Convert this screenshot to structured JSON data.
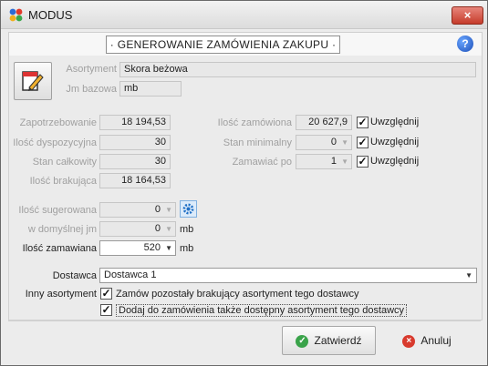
{
  "window": {
    "title": "MODUS",
    "close_glyph": "×"
  },
  "header": {
    "title": "· GENEROWANIE ZAMÓWIENIA ZAKUPU ·",
    "help_glyph": "?"
  },
  "product": {
    "asortyment_label": "Asortyment",
    "asortyment_value": "Skora beżowa",
    "jm_label": "Jm bazowa",
    "jm_value": "mb"
  },
  "stats_left": [
    {
      "label": "Zapotrzebowanie",
      "value": "18 194,53"
    },
    {
      "label": "Ilość dyspozycyjna",
      "value": "30"
    },
    {
      "label": "Stan całkowity",
      "value": "30"
    },
    {
      "label": "Ilość brakująca",
      "value": "18 164,53"
    }
  ],
  "stats_right": [
    {
      "label": "Ilość zamówiona",
      "value": "20 627,9",
      "check_label": "Uwzględnij",
      "checked": true
    },
    {
      "label": "Stan minimalny",
      "value": "0",
      "check_label": "Uwzględnij",
      "checked": true
    },
    {
      "label": "Zamawiać po",
      "value": "1",
      "check_label": "Uwzględnij",
      "checked": true
    }
  ],
  "quantity": {
    "sugerowana_label": "Ilość sugerowana",
    "sugerowana_value": "0",
    "domyslny_label": "w domyślnej jm",
    "domyslny_value": "0",
    "domyslny_unit": "mb",
    "zamawiana_label": "Ilość zamawiana",
    "zamawiana_value": "520",
    "zamawiana_unit": "mb"
  },
  "supplier": {
    "dostawca_label": "Dostawca",
    "dostawca_value": "Dostawca 1",
    "inny_label": "Inny asortyment",
    "option1": "Zamów pozostały brakujący asortyment tego dostawcy",
    "option2": "Dodaj do zamówienia także dostępny asortyment tego dostawcy"
  },
  "buttons": {
    "confirm": "Zatwierdź",
    "cancel": "Anuluj"
  },
  "glyphs": {
    "check": "✓",
    "spin": "▼",
    "dropdown": "▼"
  }
}
